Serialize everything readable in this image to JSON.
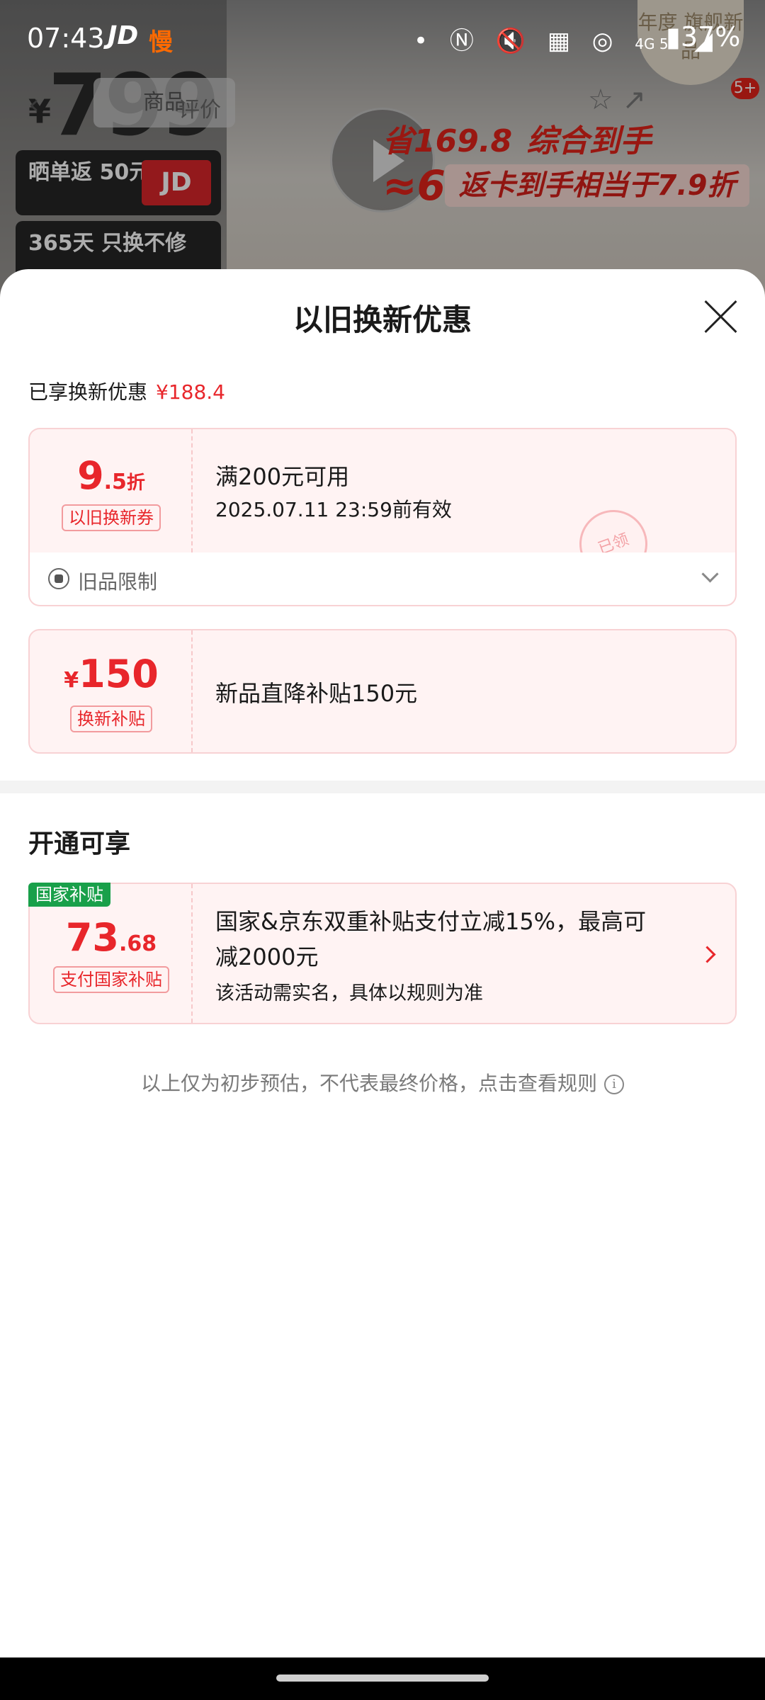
{
  "status_bar": {
    "time": "07:43",
    "app_icon_1": "JD",
    "app_icon_2": "慢",
    "icons": [
      "dot-icon",
      "nfc-icon",
      "mute-icon",
      "data-icon",
      "hotspot-icon",
      "4g-5g-signal-icon",
      "battery-icon"
    ],
    "network": "4G 5G",
    "battery": "37%"
  },
  "background": {
    "price": "799",
    "currency": "¥",
    "tab_product": "商品",
    "tab_review": "评价",
    "promo_card": "晒单返 50元E卡",
    "promo_swap": "365天 只换不修",
    "promo_save": "省169.8",
    "promo_final_label": "综合到手",
    "promo_final_price": "≈629.2",
    "promo_discount": "返卡到手相当于7.9折",
    "badge_text": "年度 旗舰新品",
    "badge_count": "5+"
  },
  "sheet": {
    "title": "以旧换新优惠",
    "enjoyed_label": "已享换新优惠",
    "enjoyed_amount": "¥188.4",
    "coupon1": {
      "value_int": "9",
      "value_dec": ".5",
      "value_unit": "折",
      "tag": "以旧换新券",
      "condition": "满200元可用",
      "validity": "2025.07.11 23:59前有效",
      "stamp": "已领"
    },
    "old_item_limit": "旧品限制",
    "coupon2": {
      "currency": "¥",
      "value": "150",
      "tag": "换新补贴",
      "desc": "新品直降补贴150元"
    },
    "section_title": "开通可享",
    "coupon3": {
      "corner_tag": "国家补贴",
      "value_int": "73",
      "value_dec": ".68",
      "tag": "支付国家补贴",
      "desc_line1": "国家&京东双重补贴支付立减15%，最高可",
      "desc_line2": "减2000元",
      "note": "该活动需实名，具体以规则为准"
    },
    "disclaimer": "以上仅为初步预估，不代表最终价格，点击查看规则"
  },
  "colors": {
    "accent_red": "#e8262b",
    "coupon_bg": "#fff3f3",
    "coupon_border": "#f8d2d4",
    "green_tag": "#19a04a"
  }
}
